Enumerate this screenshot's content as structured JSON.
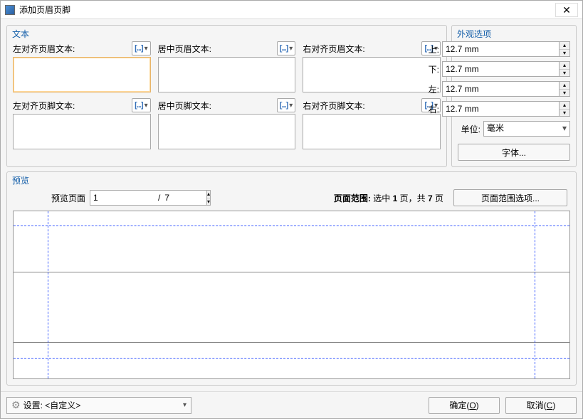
{
  "window": {
    "title": "添加页眉页脚"
  },
  "text_panel": {
    "legend": "文本",
    "fields": {
      "header_left": {
        "label": "左对齐页眉文本:"
      },
      "header_center": {
        "label": "居中页眉文本:"
      },
      "header_right": {
        "label": "右对齐页眉文本:"
      },
      "footer_left": {
        "label": "左对齐页脚文本:"
      },
      "footer_center": {
        "label": "居中页脚文本:"
      },
      "footer_right": {
        "label": "右对齐页脚文本:"
      }
    },
    "macro_glyph": "[...]"
  },
  "appearance": {
    "legend": "外观选项",
    "margins": {
      "top": {
        "label": "上:",
        "value": "12.7 mm"
      },
      "bottom": {
        "label": "下:",
        "value": "12.7 mm"
      },
      "left": {
        "label": "左:",
        "value": "12.7 mm"
      },
      "right": {
        "label": "右:",
        "value": "12.7 mm"
      }
    },
    "unit": {
      "label": "单位:",
      "value": "毫米"
    },
    "font_button": "字体..."
  },
  "preview": {
    "legend": "预览",
    "page_label": "预览页面",
    "current_page": "1",
    "total_sep": "/",
    "total_pages": "7",
    "range_prefix": "页面范围: ",
    "range_mid1": "选中 ",
    "range_sel": "1",
    "range_mid2": " 页，共 ",
    "range_total": "7",
    "range_suffix": " 页",
    "range_button": "页面范围选项..."
  },
  "bottombar": {
    "settings_label": "设置:",
    "settings_value": "<自定义>",
    "ok_label_pre": "确定(",
    "ok_key": "O",
    "ok_label_post": ")",
    "cancel_label_pre": "取消(",
    "cancel_key": "C",
    "cancel_label_post": ")"
  }
}
